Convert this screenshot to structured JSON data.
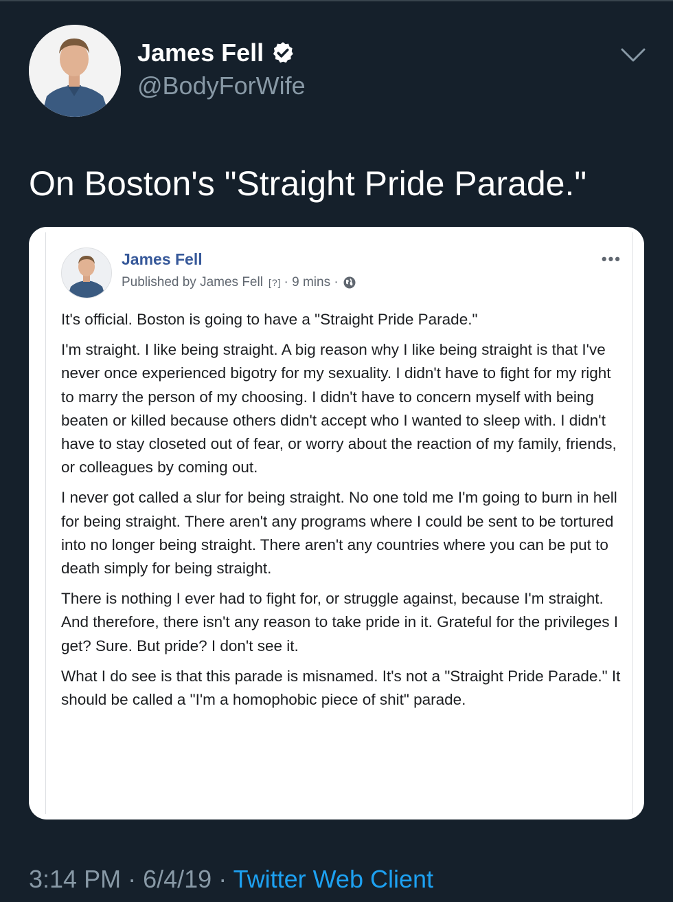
{
  "tweet": {
    "author_name": "James Fell",
    "author_handle": "@BodyForWife",
    "text": "On Boston's \"Straight Pride Parade.\"",
    "time": "3:14 PM",
    "date": "6/4/19",
    "separator": "·",
    "client": "Twitter Web Client"
  },
  "embedded_post": {
    "name": "James Fell",
    "published_by": "Published by James Fell",
    "question_mark": "[?]",
    "time_ago": "· 9 mins ·",
    "more": "•••",
    "paragraphs": [
      "It's official. Boston is going to have a \"Straight Pride Parade.\"",
      "I'm straight. I like being straight. A big reason why I like being straight is that I've never once experienced bigotry for my sexuality. I didn't have to fight for my right to marry the person of my choosing. I didn't have to concern myself with being beaten or killed because others didn't accept who I wanted to sleep with. I didn't have to stay closeted out of fear, or worry about the reaction of my family, friends, or colleagues by coming out.",
      "I never got called a slur for being straight. No one told me I'm going to burn in hell for being straight. There aren't any programs where I could be sent to be tortured into no longer being straight. There aren't any countries where you can be put to death simply for being straight.",
      "There is nothing I ever had to fight for, or struggle against, because I'm straight. And therefore, there isn't any reason to take pride in it. Grateful for the privileges I get? Sure. But pride? I don't see it.",
      "What I do see is that this parade is misnamed. It's not a \"Straight Pride Parade.\" It should be called a \"I'm a homophobic piece of shit\" parade."
    ]
  },
  "icons": {
    "verified": "verified-badge-icon",
    "chevron": "chevron-down-icon",
    "globe": "globe-icon"
  },
  "colors": {
    "background": "#15202b",
    "secondary_text": "#8899a6",
    "link": "#1da1f2",
    "fb_name": "#365899"
  }
}
